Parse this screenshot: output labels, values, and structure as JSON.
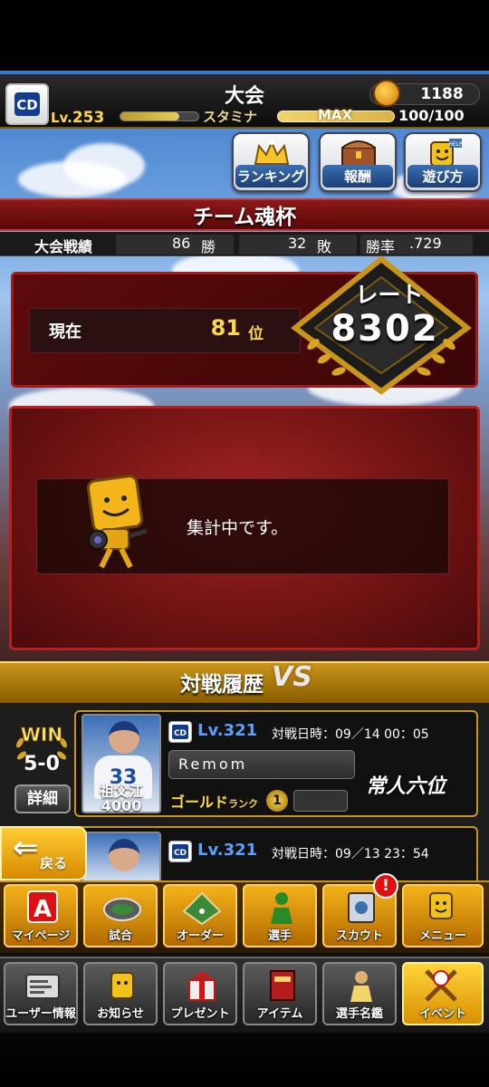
{
  "header": {
    "title": "大会",
    "coins": "1188",
    "level_label": "Lv.",
    "level": "253",
    "stamina_label": "スタミナ",
    "stamina_max_label": "MAX",
    "stamina_value": "100/100",
    "level_progress": 0.75
  },
  "top_buttons": [
    {
      "label": "ランキング",
      "icon": "crown-icon"
    },
    {
      "label": "報酬",
      "icon": "treasure-chest-icon"
    },
    {
      "label": "遊び方",
      "icon": "help-mascot-icon"
    }
  ],
  "tournament": {
    "name": "チーム魂杯",
    "record_label": "大会戦績",
    "wins": "86",
    "wins_unit": "勝",
    "losses": "32",
    "losses_unit": "敗",
    "win_rate_label": "勝率",
    "win_rate": ".729"
  },
  "ranking": {
    "current_label": "現在",
    "rank": "81",
    "rank_unit": "位",
    "rate_label": "レート",
    "rate": "8302"
  },
  "message": {
    "text": "集計中です。"
  },
  "battle_history": {
    "title": "対戦履歴",
    "vs_label": "VS",
    "win_label": "WIN",
    "score": "5-0",
    "detail_label": "詳細",
    "matches": [
      {
        "player_name": "祖父江",
        "player_score": "4000",
        "jersey": "33",
        "level": "Lv.321",
        "date_label": "対戦日時：",
        "date": "09／14 00：05",
        "username": "Remom",
        "rank_label": "ゴールド",
        "rank_sub": "ランク",
        "rank_num": "1",
        "title_text": "常人六位"
      },
      {
        "player_name": "",
        "player_score": "",
        "jersey": "",
        "level": "Lv.321",
        "date_label": "対戦日時：",
        "date": "09／13 23：54",
        "username": "",
        "rank_label": "",
        "rank_sub": "",
        "rank_num": "",
        "title_text": ""
      }
    ]
  },
  "back_button": {
    "label": "戻る"
  },
  "nav_row1": [
    {
      "label": "マイページ",
      "icon": "mypage-a-icon"
    },
    {
      "label": "試合",
      "icon": "stadium-icon"
    },
    {
      "label": "オーダー",
      "icon": "field-order-icon"
    },
    {
      "label": "選手",
      "icon": "player-icon"
    },
    {
      "label": "スカウト",
      "icon": "scout-icon",
      "badge": "!"
    },
    {
      "label": "メニュー",
      "icon": "mascot-menu-icon"
    }
  ],
  "nav_row2": [
    {
      "label": "ユーザー情報",
      "icon": "user-card-icon"
    },
    {
      "label": "お知らせ",
      "icon": "news-mascot-icon"
    },
    {
      "label": "プレゼント",
      "icon": "gift-icon"
    },
    {
      "label": "アイテム",
      "icon": "item-book-icon"
    },
    {
      "label": "選手名鑑",
      "icon": "player-book-icon"
    },
    {
      "label": "イベント",
      "icon": "event-baseball-icon"
    }
  ]
}
